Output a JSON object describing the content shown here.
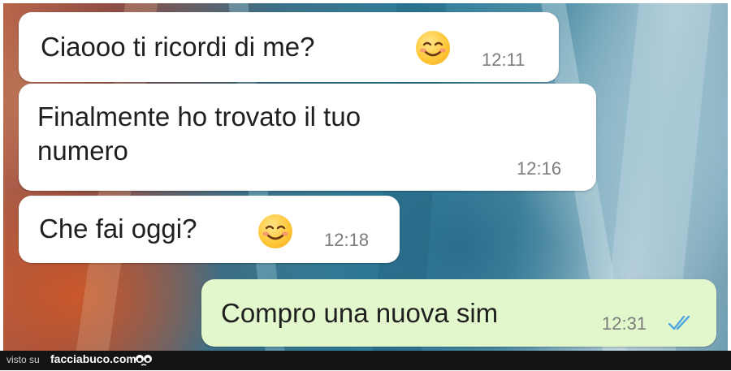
{
  "messages": [
    {
      "text": "Ciaooo ti ricordi di me?",
      "time": "12:11",
      "emoji": "smiling-face-icon",
      "direction": "incoming"
    },
    {
      "text": "Finalmente ho trovato il tuo\nnumero",
      "time": "12:16",
      "direction": "incoming"
    },
    {
      "text": "Che fai oggi?",
      "time": "12:18",
      "emoji": "smiling-face-icon",
      "direction": "incoming"
    },
    {
      "text": "Compro una nuova sim",
      "time": "12:31",
      "status": "read",
      "status_icon": "double-check-icon",
      "direction": "outgoing"
    }
  ],
  "colors": {
    "incoming_bubble": "#ffffff",
    "outgoing_bubble": "#e2f7cb",
    "read_ticks": "#4fa6e0",
    "footer_bg": "#141414"
  },
  "footer": {
    "visto_su": "visto su",
    "site": "facciabuco.com",
    "logo_icon": "facciabuco-eyes-logo"
  }
}
